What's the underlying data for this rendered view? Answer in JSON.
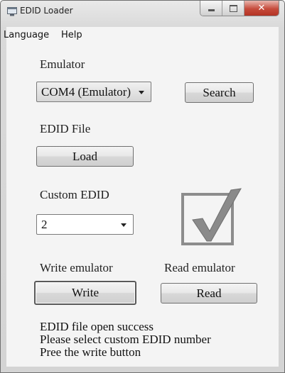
{
  "window": {
    "title": "EDID Loader",
    "icon": "app-window-icon",
    "controls": [
      "minimize-icon",
      "maximize-icon",
      "close-icon"
    ]
  },
  "menu": {
    "language": "Language",
    "help": "Help"
  },
  "emulator": {
    "label": "Emulator",
    "selected": "COM4 (Emulator)",
    "search_label": "Search"
  },
  "edid_file": {
    "label": "EDID File",
    "load_label": "Load"
  },
  "custom_edid": {
    "label": "Custom EDID",
    "selected": "2",
    "indicator_icon": "checkmark-icon"
  },
  "write": {
    "label": "Write emulator",
    "button_label": "Write"
  },
  "read": {
    "label": "Read emulator",
    "button_label": "Read"
  },
  "status": {
    "line1": "EDID file open success",
    "line2": "Please select custom EDID number",
    "line3": "Pree the write button"
  },
  "colors": {
    "window_frame": "#d9d9d9",
    "client_bg": "#f4f4f4",
    "close_button": "#c64b3b"
  }
}
